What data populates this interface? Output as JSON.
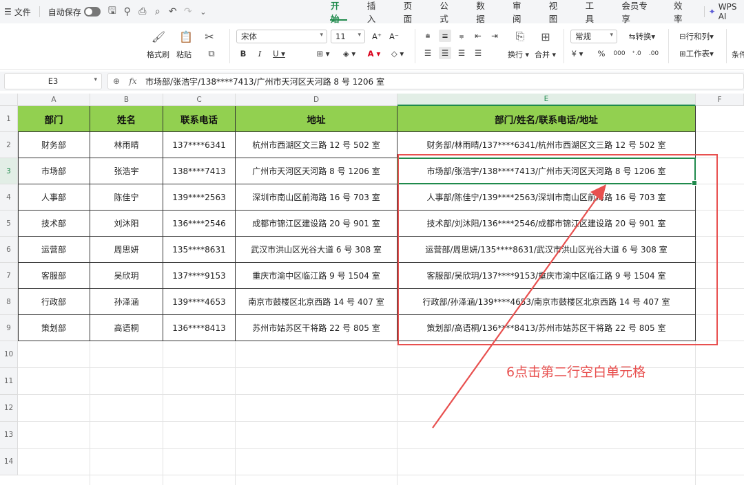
{
  "menubar": {
    "file_label": "文件",
    "autosave_label": "自动保存",
    "tabs": [
      "开始",
      "插入",
      "页面",
      "公式",
      "数据",
      "审阅",
      "视图",
      "工具",
      "会员专享",
      "效率"
    ],
    "active_tab": "开始",
    "wps_ai_label": "WPS AI"
  },
  "ribbon": {
    "format_painter": "格式刷",
    "paste": "粘贴",
    "font_name": "宋体",
    "font_size": "11",
    "number_format": "常规",
    "convert": "转换",
    "rows_cols": "行和列",
    "wrap": "换行",
    "merge": "合并",
    "worksheet": "工作表",
    "cond": "条件",
    "font_color": "#d9001b",
    "fill_color": "#f5d400"
  },
  "formula_bar": {
    "cell_ref": "E3",
    "fx_label": "fx",
    "content": "市场部/张浩宇/138****7413/广州市天河区天河路 8 号 1206 室"
  },
  "grid": {
    "columns": [
      "A",
      "B",
      "C",
      "D",
      "E",
      "F"
    ],
    "selected_column": "E",
    "row_numbers": [
      "1",
      "2",
      "3",
      "4",
      "5",
      "6",
      "7",
      "8",
      "9",
      "10",
      "11",
      "12",
      "13",
      "14"
    ],
    "selected_row": "3",
    "headers": [
      "部门",
      "姓名",
      "联系电话",
      "地址",
      "部门/姓名/联系电话/地址"
    ],
    "rows": [
      [
        "财务部",
        "林雨晴",
        "137****6341",
        "杭州市西湖区文三路 12 号 502 室",
        "财务部/林雨晴/137****6341/杭州市西湖区文三路 12 号 502 室"
      ],
      [
        "市场部",
        "张浩宇",
        "138****7413",
        "广州市天河区天河路 8 号 1206 室",
        "市场部/张浩宇/138****7413/广州市天河区天河路 8 号 1206 室"
      ],
      [
        "人事部",
        "陈佳宁",
        "139****2563",
        "深圳市南山区前海路 16 号 703 室",
        "人事部/陈佳宁/139****2563/深圳市南山区前海路 16 号 703 室"
      ],
      [
        "技术部",
        "刘沐阳",
        "136****2546",
        "成都市锦江区建设路 20 号 901 室",
        "技术部/刘沐阳/136****2546/成都市锦江区建设路 20 号 901 室"
      ],
      [
        "运营部",
        "周思妍",
        "135****8631",
        "武汉市洪山区光谷大道 6 号 308 室",
        "运营部/周思妍/135****8631/武汉市洪山区光谷大道 6 号 308 室"
      ],
      [
        "客服部",
        "吴欣玥",
        "137****9153",
        "重庆市渝中区临江路 9 号 1504 室",
        "客服部/吴欣玥/137****9153/重庆市渝中区临江路 9 号 1504 室"
      ],
      [
        "行政部",
        "孙泽涵",
        "139****4653",
        "南京市鼓楼区北京西路 14 号 407 室",
        "行政部/孙泽涵/139****4653/南京市鼓楼区北京西路 14 号 407 室"
      ],
      [
        "策划部",
        "高语桐",
        "136****8413",
        "苏州市姑苏区干将路 22 号 805 室",
        "策划部/高语桐/136****8413/苏州市姑苏区干将路 22 号 805 室"
      ]
    ],
    "header_fill": "#92d050"
  },
  "annotation": {
    "text": "6点击第二行空白单元格",
    "color": "#e8504f"
  }
}
